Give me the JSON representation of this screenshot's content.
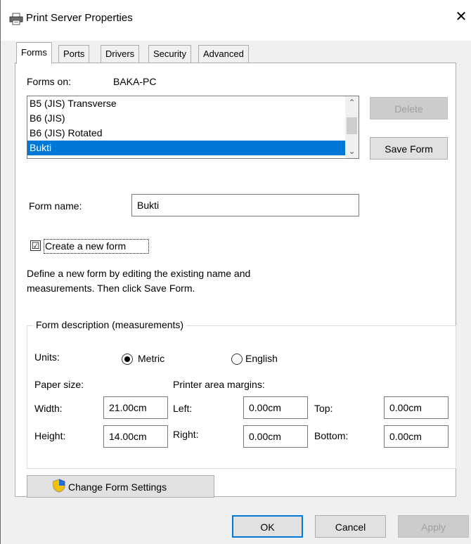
{
  "window": {
    "title": "Print Server Properties"
  },
  "tabs": [
    {
      "label": "Forms"
    },
    {
      "label": "Ports"
    },
    {
      "label": "Drivers"
    },
    {
      "label": "Security"
    },
    {
      "label": "Advanced"
    }
  ],
  "forms": {
    "forms_on_label": "Forms on:",
    "server_name": "BAKA-PC",
    "list_items": [
      "B5 (JIS) Transverse",
      "B6 (JIS)",
      "B6 (JIS) Rotated",
      "Bukti"
    ],
    "selected_item": "Bukti",
    "delete_label": "Delete",
    "save_form_label": "Save Form",
    "form_name_label": "Form name:",
    "form_name_value": "Bukti",
    "create_new_label": "Create a new form",
    "create_new_checked": "☑",
    "description": "Define a new form by editing the existing name and",
    "description2": "measurements. Then click Save Form."
  },
  "measurements": {
    "group_title": "Form description (measurements)",
    "units_label": "Units:",
    "metric_label": "Metric",
    "english_label": "English",
    "paper_size_label": "Paper size:",
    "margins_label": "Printer area margins:",
    "width_label": "Width:",
    "width_value": "21.00cm",
    "height_label": "Height:",
    "height_value": "14.00cm",
    "left_label": "Left:",
    "left_value": "0.00cm",
    "right_label": "Right:",
    "right_value": "0.00cm",
    "top_label": "Top:",
    "top_value": "0.00cm",
    "bottom_label": "Bottom:",
    "bottom_value": "0.00cm"
  },
  "change_settings_label": "Change Form Settings",
  "footer": {
    "ok_label": "OK",
    "cancel_label": "Cancel",
    "apply_label": "Apply"
  },
  "colors": {
    "selection": "#0078d7",
    "accent": "#0078d7"
  }
}
